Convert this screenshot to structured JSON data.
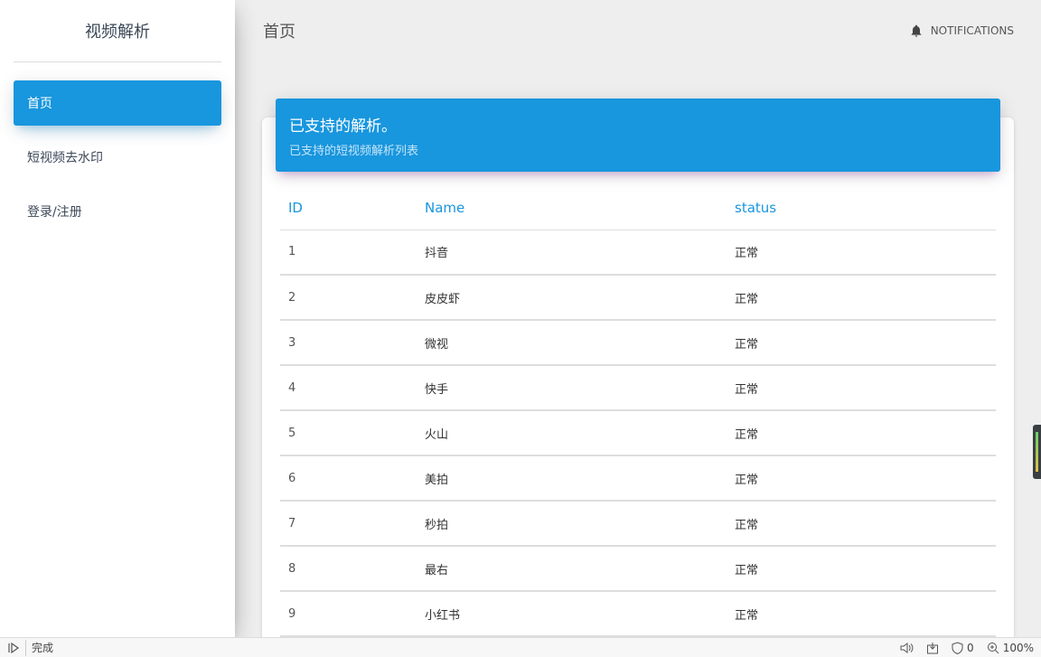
{
  "sidebar": {
    "brand": "视频解析",
    "items": [
      {
        "label": "首页",
        "active": true
      },
      {
        "label": "短视频去水印",
        "active": false
      },
      {
        "label": "登录/注册",
        "active": false
      }
    ]
  },
  "topbar": {
    "title": "首页",
    "notifications_label": "NOTIFICATIONS"
  },
  "card": {
    "title": "已支持的解析。",
    "subtitle": "已支持的短视频解析列表",
    "columns": [
      "ID",
      "Name",
      "status"
    ],
    "rows": [
      {
        "id": "1",
        "name": "抖音",
        "status": "正常"
      },
      {
        "id": "2",
        "name": "皮皮虾",
        "status": "正常"
      },
      {
        "id": "3",
        "name": "微视",
        "status": "正常"
      },
      {
        "id": "4",
        "name": "快手",
        "status": "正常"
      },
      {
        "id": "5",
        "name": "火山",
        "status": "正常"
      },
      {
        "id": "6",
        "name": "美拍",
        "status": "正常"
      },
      {
        "id": "7",
        "name": "秒拍",
        "status": "正常"
      },
      {
        "id": "8",
        "name": "最右",
        "status": "正常"
      },
      {
        "id": "9",
        "name": "小红书",
        "status": "正常"
      }
    ]
  },
  "statusbar": {
    "status": "完成",
    "adblock_count": "0",
    "zoom": "100%"
  },
  "colors": {
    "accent": "#1896de"
  }
}
